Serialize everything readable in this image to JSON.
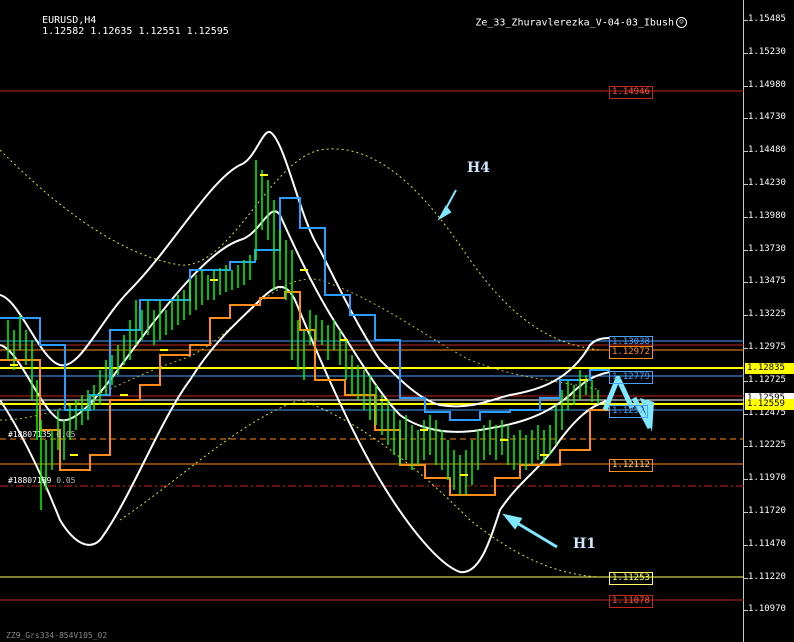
{
  "title": {
    "symbol_timeframe": "EURUSD,H4",
    "ohlc": "1.12582 1.12635 1.12551 1.12595"
  },
  "expert": {
    "name": "Ze_33_Zhuravlerezka_V-04-03_Ibush",
    "icon": "smiley-icon"
  },
  "price_scale": {
    "ticks": [
      "1.15485",
      "1.15230",
      "1.14980",
      "1.14730",
      "1.14480",
      "1.14230",
      "1.13980",
      "1.13730",
      "1.13475",
      "1.13225",
      "1.12975",
      "1.12725",
      "1.12475",
      "1.12225",
      "1.11970",
      "1.11720",
      "1.11470",
      "1.11220",
      "1.10970"
    ],
    "current_price": "1.12595",
    "highlight_price": "1.12835",
    "highlight_price_2": "1.12559"
  },
  "levels": {
    "red_top": "1.14946",
    "blue_1": "1.13038",
    "orange_1": "1.12972",
    "blue_2": "1.12779",
    "yellow_mid": "1.12835",
    "blue_3": "1.1257",
    "orange_low": "1.12112",
    "yellow_low": "1.11253",
    "red_low": "1.11078"
  },
  "left_labels": {
    "a": "#18807135",
    "a_suffix": "0.05",
    "b": "#18807139",
    "b_suffix": "0.05"
  },
  "annotations": {
    "h4": "H4",
    "h1": "H1"
  },
  "footer": "ZZ9_Grs334-854V105_02",
  "colors": {
    "background": "#000000",
    "candles": "#00ff00",
    "bands": "#ffffff",
    "blue_channel": "#1e90ff",
    "orange_channel": "#ff8c1a",
    "yellow": "#ffff00",
    "red_line": "#ff3030",
    "arrow": "#7fe8ff"
  }
}
